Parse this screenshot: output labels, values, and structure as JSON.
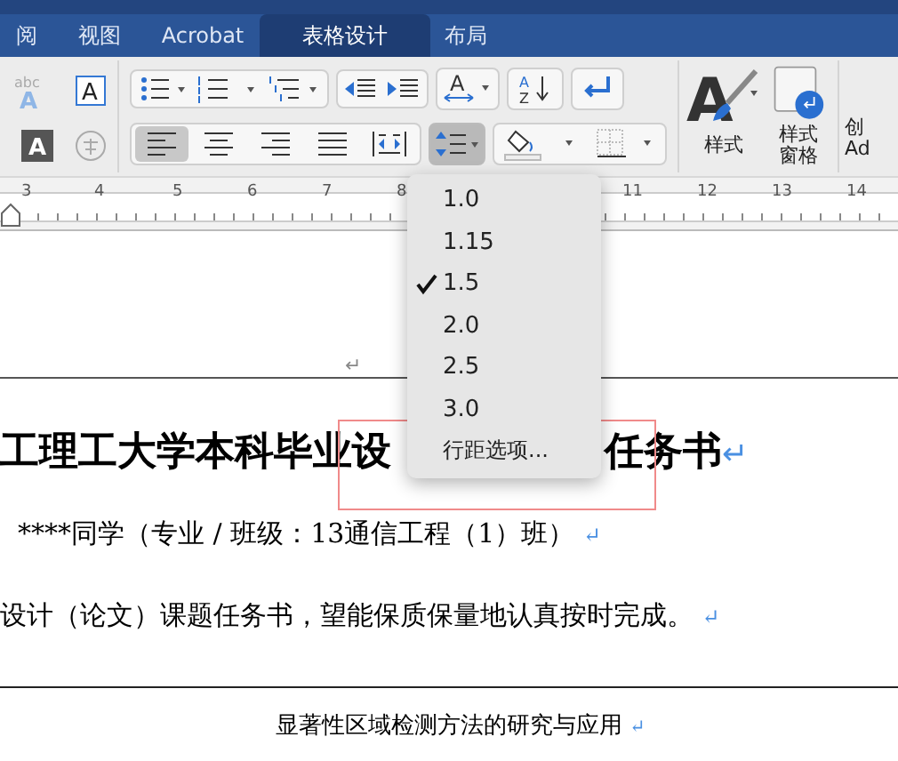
{
  "tabs": [
    {
      "label": "阅",
      "selected": false
    },
    {
      "label": "视图",
      "selected": false
    },
    {
      "label": "Acrobat",
      "selected": false
    },
    {
      "label": "表格设计",
      "selected": true
    },
    {
      "label": "布局",
      "selected": false
    }
  ],
  "ribbon": {
    "align_buttons": [
      {
        "kind": "left",
        "selected": true
      },
      {
        "kind": "center",
        "selected": false
      },
      {
        "kind": "right",
        "selected": false
      },
      {
        "kind": "justify",
        "selected": false
      },
      {
        "kind": "distributed",
        "selected": false
      }
    ],
    "line_spacing_pressed": true,
    "glyphs": {
      "effect_small": "abc",
      "effect_big": "A",
      "textbox": "A",
      "highlight": "A",
      "spacing": "A",
      "sort_a": "A",
      "sort_z": "Z",
      "styles": "A"
    },
    "styles_label": "样式",
    "styles_pane_label": "样式窗格",
    "create_label_1": "创",
    "create_label_2": "Ad"
  },
  "ruler": {
    "numbers": [
      "3",
      "4",
      "5",
      "6",
      "7",
      "8",
      "11",
      "12",
      "13",
      "14"
    ]
  },
  "line_spacing_menu": {
    "items": [
      {
        "label": "1.0",
        "checked": false
      },
      {
        "label": "1.15",
        "checked": false
      },
      {
        "label": "1.5",
        "checked": true
      },
      {
        "label": "2.0",
        "checked": false
      },
      {
        "label": "2.5",
        "checked": false
      },
      {
        "label": "3.0",
        "checked": false
      }
    ],
    "options": "行距选项..."
  },
  "document": {
    "stray_mark": "↵",
    "title_left": "工理工大学本科毕业设",
    "title_right": "任务书",
    "title_mark": "↵",
    "line_1": "****同学（专业 / 班级：13通信工程（1）班）",
    "line_1_mark": "↵",
    "line_2": "设计（论文）课题任务书，望能保质保量地认真按时完成。",
    "line_2_mark": "↵",
    "footer": "显著性区域检测方法的研究与应用",
    "footer_mark": "↵"
  }
}
